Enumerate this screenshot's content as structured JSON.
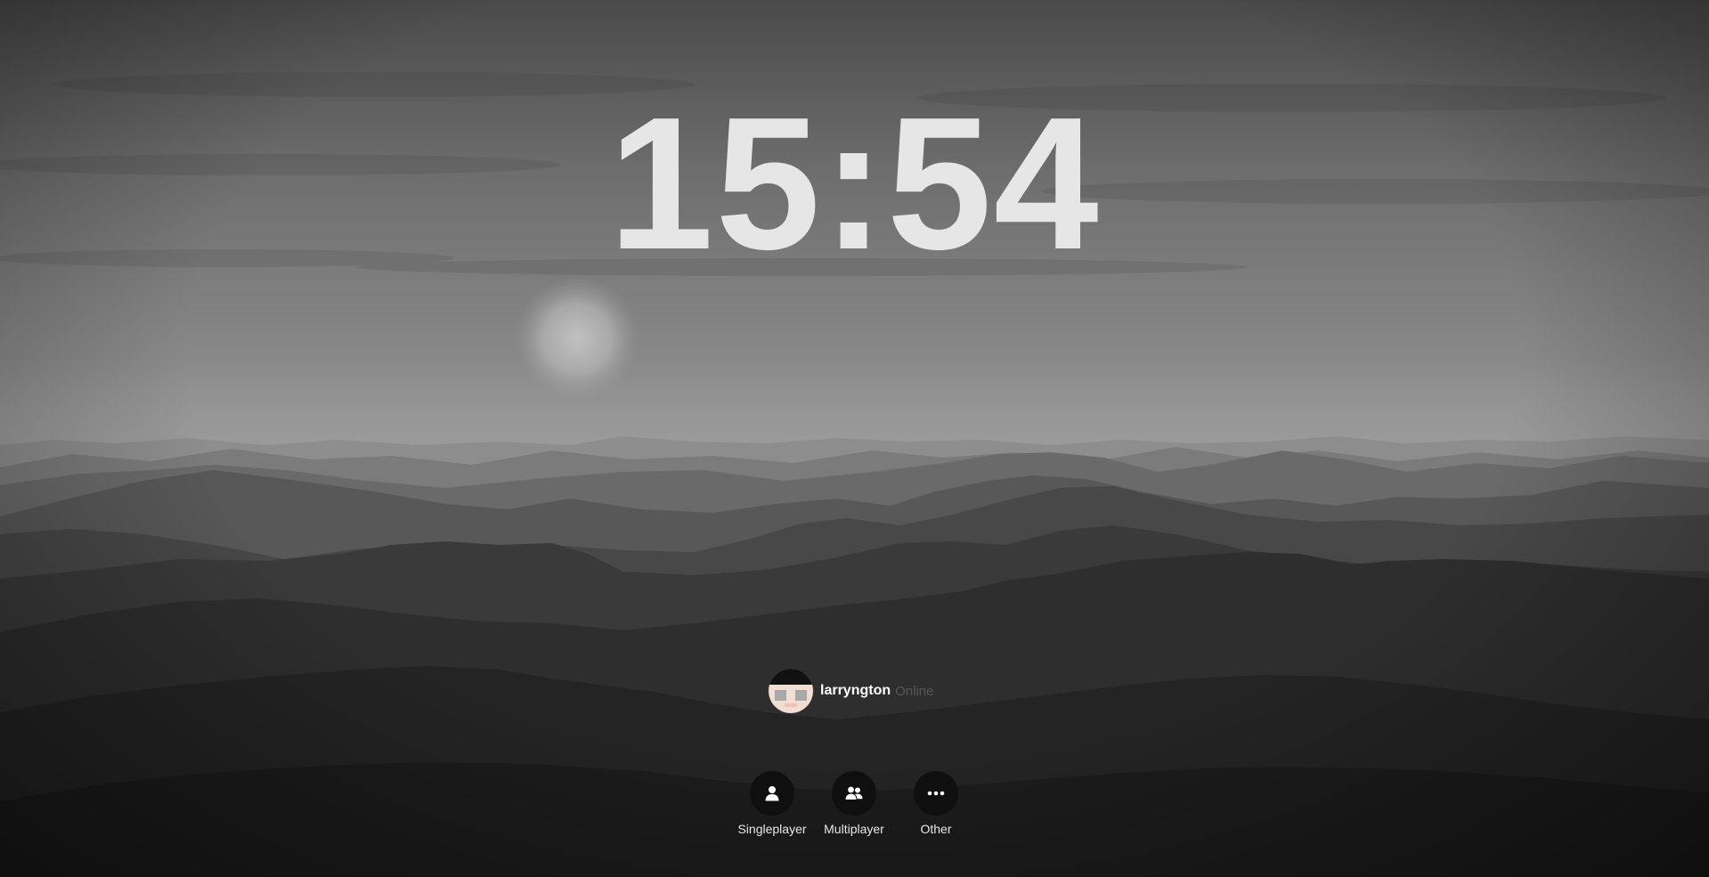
{
  "clock": {
    "time": "15:54"
  },
  "profile": {
    "username": "larryngton",
    "status": "Online",
    "avatar_icon": "player-head-avatar"
  },
  "actions": [
    {
      "label": "Singleplayer",
      "icon": "person-icon"
    },
    {
      "label": "Multiplayer",
      "icon": "people-icon"
    },
    {
      "label": "Other",
      "icon": "more-dots-icon"
    }
  ],
  "colors": {
    "clock_text": "#e6e6e6",
    "button_bg": "#0f0f0f",
    "status_text": "#555555"
  }
}
